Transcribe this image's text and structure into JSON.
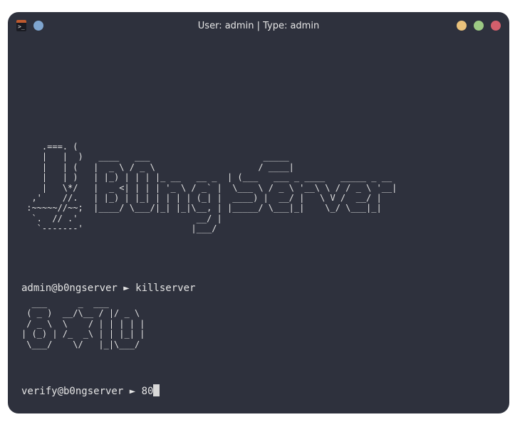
{
  "window": {
    "title": "User: admin | Type: admin"
  },
  "terminal": {
    "logo_art": "    .===. (\n    |   |  )   ____   ___                      _____\n    |   | (   |  _ \\ / _ \\                    / ____|\n    |   | )   | |_) | | | |_ __   __ _  | (___   ___ _ ____   _____ _ __\n    |   \\*/   |  _ <| | | | '_ \\ / _` |  \\___ \\ / _ \\ '__\\ \\ / / _ \\ '__|\n  ,'    //.   | |_) | |_| | | | | (_| |  ____) |  __/ |   \\ V /  __/ |\n :~~~~~//~~;  |____/ \\___/|_| |_|\\__, | |_____/ \\___|_|    \\_/ \\___|_|\n  `.  // .'                       __/ |\n   `-------'                     |___/",
    "command_1": "admin@b0ngserver ► killserver",
    "number_art": "  ___      _  ___\n ( _ )  __/\\__ / |/ _ \\\n / _ \\  \\    / | | | | |\n| (_) | /_  _\\ | | |_| |\n \\___/    \\/   |_|\\___/",
    "command_2": "verify@b0ngserver ► 80"
  },
  "colors": {
    "terminal_bg": "#2e313d",
    "text": "#e4e4e4",
    "dot_blue": "#7fa5cf",
    "dot_yellow": "#e9c17b",
    "dot_green": "#9cc983",
    "dot_red": "#d35f6c"
  },
  "icons": {
    "app": "terminal-app-icon",
    "blue": "pin-dot-icon",
    "minimize": "minimize-dot-icon",
    "maximize": "maximize-dot-icon",
    "close": "close-dot-icon"
  }
}
